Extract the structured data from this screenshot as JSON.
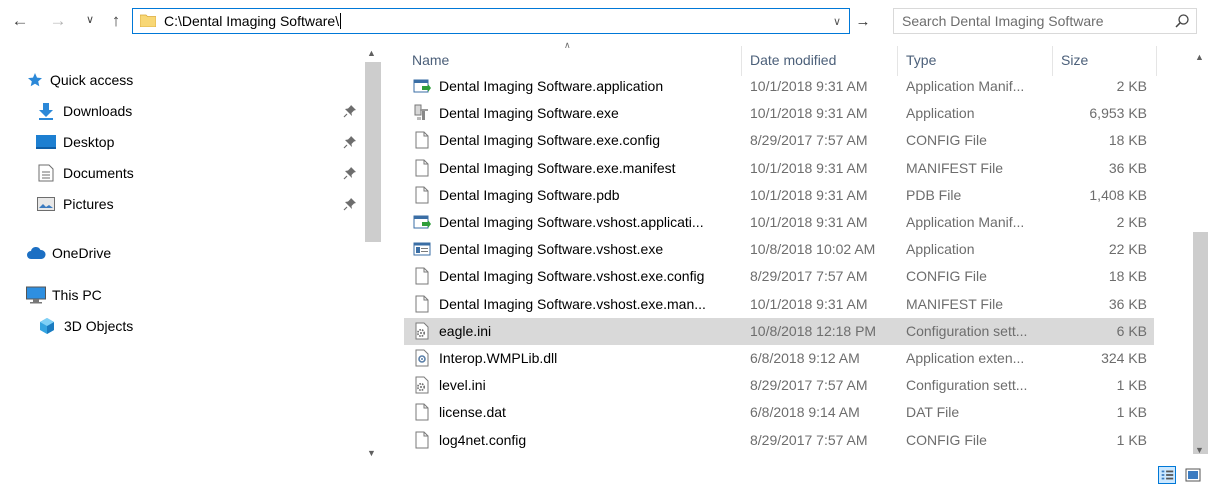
{
  "address_bar": {
    "path": "C:\\Dental Imaging Software\\",
    "search_placeholder": "Search Dental Imaging Software"
  },
  "nav_pane": {
    "quick_access": "Quick access",
    "pinned": [
      {
        "label": "Downloads",
        "icon": "download-arrow-icon"
      },
      {
        "label": "Desktop",
        "icon": "desktop-icon"
      },
      {
        "label": "Documents",
        "icon": "documents-icon"
      },
      {
        "label": "Pictures",
        "icon": "pictures-icon"
      }
    ],
    "onedrive": "OneDrive",
    "this_pc": "This PC",
    "objects_3d": "3D Objects"
  },
  "columns": {
    "name": "Name",
    "date": "Date modified",
    "type": "Type",
    "size": "Size"
  },
  "files": [
    {
      "name": "Dental Imaging Software.application",
      "date": "10/1/2018 9:31 AM",
      "type": "Application Manif...",
      "size": "2 KB",
      "icon": "app-manifest-icon"
    },
    {
      "name": "Dental Imaging Software.exe",
      "date": "10/1/2018 9:31 AM",
      "type": "Application",
      "size": "6,953 KB",
      "icon": "exe-icon"
    },
    {
      "name": "Dental Imaging Software.exe.config",
      "date": "8/29/2017 7:57 AM",
      "type": "CONFIG File",
      "size": "18 KB",
      "icon": "file-icon"
    },
    {
      "name": "Dental Imaging Software.exe.manifest",
      "date": "10/1/2018 9:31 AM",
      "type": "MANIFEST File",
      "size": "36 KB",
      "icon": "file-icon"
    },
    {
      "name": "Dental Imaging Software.pdb",
      "date": "10/1/2018 9:31 AM",
      "type": "PDB File",
      "size": "1,408 KB",
      "icon": "file-icon"
    },
    {
      "name": "Dental Imaging Software.vshost.applicati...",
      "date": "10/1/2018 9:31 AM",
      "type": "Application Manif...",
      "size": "2 KB",
      "icon": "app-manifest-icon"
    },
    {
      "name": "Dental Imaging Software.vshost.exe",
      "date": "10/8/2018 10:02 AM",
      "type": "Application",
      "size": "22 KB",
      "icon": "window-exe-icon"
    },
    {
      "name": "Dental Imaging Software.vshost.exe.config",
      "date": "8/29/2017 7:57 AM",
      "type": "CONFIG File",
      "size": "18 KB",
      "icon": "file-icon"
    },
    {
      "name": "Dental Imaging Software.vshost.exe.man...",
      "date": "10/1/2018 9:31 AM",
      "type": "MANIFEST File",
      "size": "36 KB",
      "icon": "file-icon"
    },
    {
      "name": "eagle.ini",
      "date": "10/8/2018 12:18 PM",
      "type": "Configuration sett...",
      "size": "6 KB",
      "icon": "ini-gear-icon",
      "selected": true
    },
    {
      "name": "Interop.WMPLib.dll",
      "date": "6/8/2018 9:12 AM",
      "type": "Application exten...",
      "size": "324 KB",
      "icon": "dll-icon"
    },
    {
      "name": "level.ini",
      "date": "8/29/2017 7:57 AM",
      "type": "Configuration sett...",
      "size": "1 KB",
      "icon": "ini-gear-icon"
    },
    {
      "name": "license.dat",
      "date": "6/8/2018 9:14 AM",
      "type": "DAT File",
      "size": "1 KB",
      "icon": "file-icon"
    },
    {
      "name": "log4net.config",
      "date": "8/29/2017 7:57 AM",
      "type": "CONFIG File",
      "size": "1 KB",
      "icon": "file-icon"
    }
  ],
  "colors": {
    "accent": "#0078d7",
    "selected_row": "#d9d9d9",
    "header_text": "#4c607a",
    "detail_text": "#6d6d6d",
    "folder_yellow": "#f8d775"
  }
}
